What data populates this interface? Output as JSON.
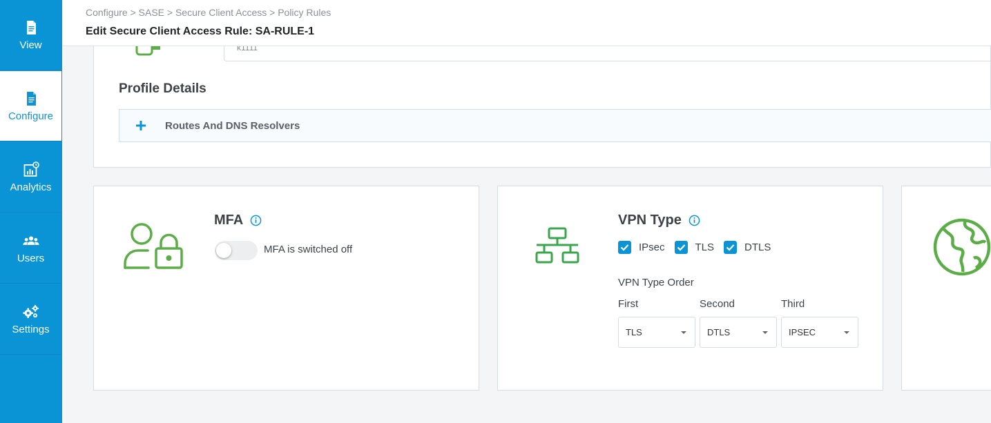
{
  "sidebar": {
    "items": [
      {
        "label": "View",
        "icon": "document-icon",
        "active": false
      },
      {
        "label": "Configure",
        "icon": "document-icon",
        "active": true
      },
      {
        "label": "Analytics",
        "icon": "analytics-icon",
        "active": false
      },
      {
        "label": "Users",
        "icon": "users-icon",
        "active": false
      },
      {
        "label": "Settings",
        "icon": "gears-icon",
        "active": false
      }
    ]
  },
  "header": {
    "breadcrumb": "Configure > SASE > Secure Client Access > Policy Rules",
    "title": "Edit Secure Client Access Rule: SA-RULE-1"
  },
  "top_card": {
    "input_value": "k1111",
    "profile_title": "Profile Details",
    "accordion_label": "Routes And DNS Resolvers",
    "accordion_icon": "plus-icon"
  },
  "mfa": {
    "title": "MFA",
    "toggle_label": "MFA is switched off",
    "enabled": false
  },
  "vpn": {
    "title": "VPN Type",
    "checkboxes": [
      {
        "label": "IPsec",
        "checked": true
      },
      {
        "label": "TLS",
        "checked": true
      },
      {
        "label": "DTLS",
        "checked": true
      }
    ],
    "order_label": "VPN Type Order",
    "order": [
      {
        "label": "First",
        "value": "TLS"
      },
      {
        "label": "Second",
        "value": "DTLS"
      },
      {
        "label": "Third",
        "value": "IPSEC"
      }
    ]
  },
  "colors": {
    "sidebar_blue": "#0a94d6",
    "icon_green": "#5cad47",
    "info_blue": "#0a94d6"
  }
}
